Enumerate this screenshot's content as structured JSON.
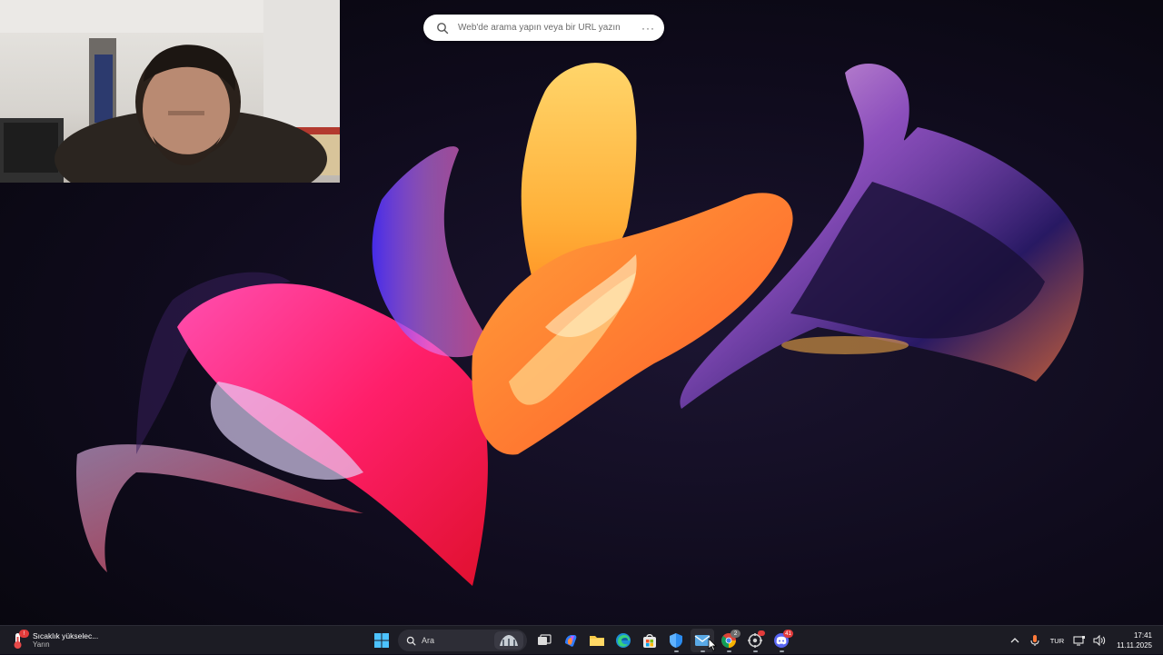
{
  "browser_search": {
    "placeholder": "Web'de arama yapın veya bir URL yazın",
    "icon": "search-icon",
    "menu_icon": "more-icon"
  },
  "taskbar": {
    "weather": {
      "title": "Sıcaklık yükselec...",
      "subtitle": "Yarın",
      "badge": "!"
    },
    "search": {
      "label": "Ara"
    },
    "pinned_apps": [
      {
        "name": "task-view"
      },
      {
        "name": "copilot"
      },
      {
        "name": "file-explorer"
      },
      {
        "name": "edge"
      },
      {
        "name": "microsoft-store"
      },
      {
        "name": "defender"
      },
      {
        "name": "mail-app"
      },
      {
        "name": "chrome"
      },
      {
        "name": "app-launcher"
      },
      {
        "name": "discord"
      }
    ],
    "chrome_badge": "2",
    "discord_badge": "41",
    "tray": {
      "language": "TUR",
      "time": "17:41",
      "date": "11.11.2025"
    }
  },
  "colors": {
    "taskbar_bg": "#1c1c24",
    "desktop_bg": "#0f0b1c",
    "accent_pink": "#ff2d7a",
    "accent_orange": "#ff8a2a",
    "accent_yellow": "#ffc64a"
  }
}
